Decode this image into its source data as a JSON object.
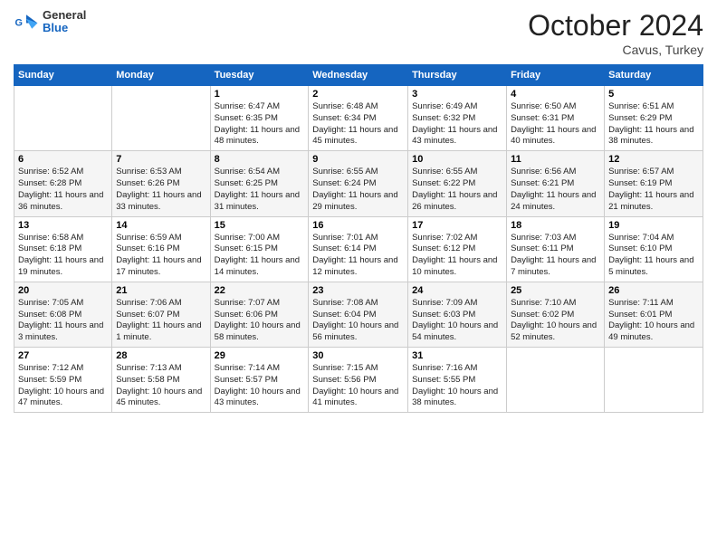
{
  "header": {
    "logo_line1": "General",
    "logo_line2": "Blue",
    "month": "October 2024",
    "location": "Cavus, Turkey"
  },
  "weekdays": [
    "Sunday",
    "Monday",
    "Tuesday",
    "Wednesday",
    "Thursday",
    "Friday",
    "Saturday"
  ],
  "weeks": [
    [
      {
        "day": "",
        "text": ""
      },
      {
        "day": "",
        "text": ""
      },
      {
        "day": "1",
        "text": "Sunrise: 6:47 AM\nSunset: 6:35 PM\nDaylight: 11 hours and 48 minutes."
      },
      {
        "day": "2",
        "text": "Sunrise: 6:48 AM\nSunset: 6:34 PM\nDaylight: 11 hours and 45 minutes."
      },
      {
        "day": "3",
        "text": "Sunrise: 6:49 AM\nSunset: 6:32 PM\nDaylight: 11 hours and 43 minutes."
      },
      {
        "day": "4",
        "text": "Sunrise: 6:50 AM\nSunset: 6:31 PM\nDaylight: 11 hours and 40 minutes."
      },
      {
        "day": "5",
        "text": "Sunrise: 6:51 AM\nSunset: 6:29 PM\nDaylight: 11 hours and 38 minutes."
      }
    ],
    [
      {
        "day": "6",
        "text": "Sunrise: 6:52 AM\nSunset: 6:28 PM\nDaylight: 11 hours and 36 minutes."
      },
      {
        "day": "7",
        "text": "Sunrise: 6:53 AM\nSunset: 6:26 PM\nDaylight: 11 hours and 33 minutes."
      },
      {
        "day": "8",
        "text": "Sunrise: 6:54 AM\nSunset: 6:25 PM\nDaylight: 11 hours and 31 minutes."
      },
      {
        "day": "9",
        "text": "Sunrise: 6:55 AM\nSunset: 6:24 PM\nDaylight: 11 hours and 29 minutes."
      },
      {
        "day": "10",
        "text": "Sunrise: 6:55 AM\nSunset: 6:22 PM\nDaylight: 11 hours and 26 minutes."
      },
      {
        "day": "11",
        "text": "Sunrise: 6:56 AM\nSunset: 6:21 PM\nDaylight: 11 hours and 24 minutes."
      },
      {
        "day": "12",
        "text": "Sunrise: 6:57 AM\nSunset: 6:19 PM\nDaylight: 11 hours and 21 minutes."
      }
    ],
    [
      {
        "day": "13",
        "text": "Sunrise: 6:58 AM\nSunset: 6:18 PM\nDaylight: 11 hours and 19 minutes."
      },
      {
        "day": "14",
        "text": "Sunrise: 6:59 AM\nSunset: 6:16 PM\nDaylight: 11 hours and 17 minutes."
      },
      {
        "day": "15",
        "text": "Sunrise: 7:00 AM\nSunset: 6:15 PM\nDaylight: 11 hours and 14 minutes."
      },
      {
        "day": "16",
        "text": "Sunrise: 7:01 AM\nSunset: 6:14 PM\nDaylight: 11 hours and 12 minutes."
      },
      {
        "day": "17",
        "text": "Sunrise: 7:02 AM\nSunset: 6:12 PM\nDaylight: 11 hours and 10 minutes."
      },
      {
        "day": "18",
        "text": "Sunrise: 7:03 AM\nSunset: 6:11 PM\nDaylight: 11 hours and 7 minutes."
      },
      {
        "day": "19",
        "text": "Sunrise: 7:04 AM\nSunset: 6:10 PM\nDaylight: 11 hours and 5 minutes."
      }
    ],
    [
      {
        "day": "20",
        "text": "Sunrise: 7:05 AM\nSunset: 6:08 PM\nDaylight: 11 hours and 3 minutes."
      },
      {
        "day": "21",
        "text": "Sunrise: 7:06 AM\nSunset: 6:07 PM\nDaylight: 11 hours and 1 minute."
      },
      {
        "day": "22",
        "text": "Sunrise: 7:07 AM\nSunset: 6:06 PM\nDaylight: 10 hours and 58 minutes."
      },
      {
        "day": "23",
        "text": "Sunrise: 7:08 AM\nSunset: 6:04 PM\nDaylight: 10 hours and 56 minutes."
      },
      {
        "day": "24",
        "text": "Sunrise: 7:09 AM\nSunset: 6:03 PM\nDaylight: 10 hours and 54 minutes."
      },
      {
        "day": "25",
        "text": "Sunrise: 7:10 AM\nSunset: 6:02 PM\nDaylight: 10 hours and 52 minutes."
      },
      {
        "day": "26",
        "text": "Sunrise: 7:11 AM\nSunset: 6:01 PM\nDaylight: 10 hours and 49 minutes."
      }
    ],
    [
      {
        "day": "27",
        "text": "Sunrise: 7:12 AM\nSunset: 5:59 PM\nDaylight: 10 hours and 47 minutes."
      },
      {
        "day": "28",
        "text": "Sunrise: 7:13 AM\nSunset: 5:58 PM\nDaylight: 10 hours and 45 minutes."
      },
      {
        "day": "29",
        "text": "Sunrise: 7:14 AM\nSunset: 5:57 PM\nDaylight: 10 hours and 43 minutes."
      },
      {
        "day": "30",
        "text": "Sunrise: 7:15 AM\nSunset: 5:56 PM\nDaylight: 10 hours and 41 minutes."
      },
      {
        "day": "31",
        "text": "Sunrise: 7:16 AM\nSunset: 5:55 PM\nDaylight: 10 hours and 38 minutes."
      },
      {
        "day": "",
        "text": ""
      },
      {
        "day": "",
        "text": ""
      }
    ]
  ]
}
